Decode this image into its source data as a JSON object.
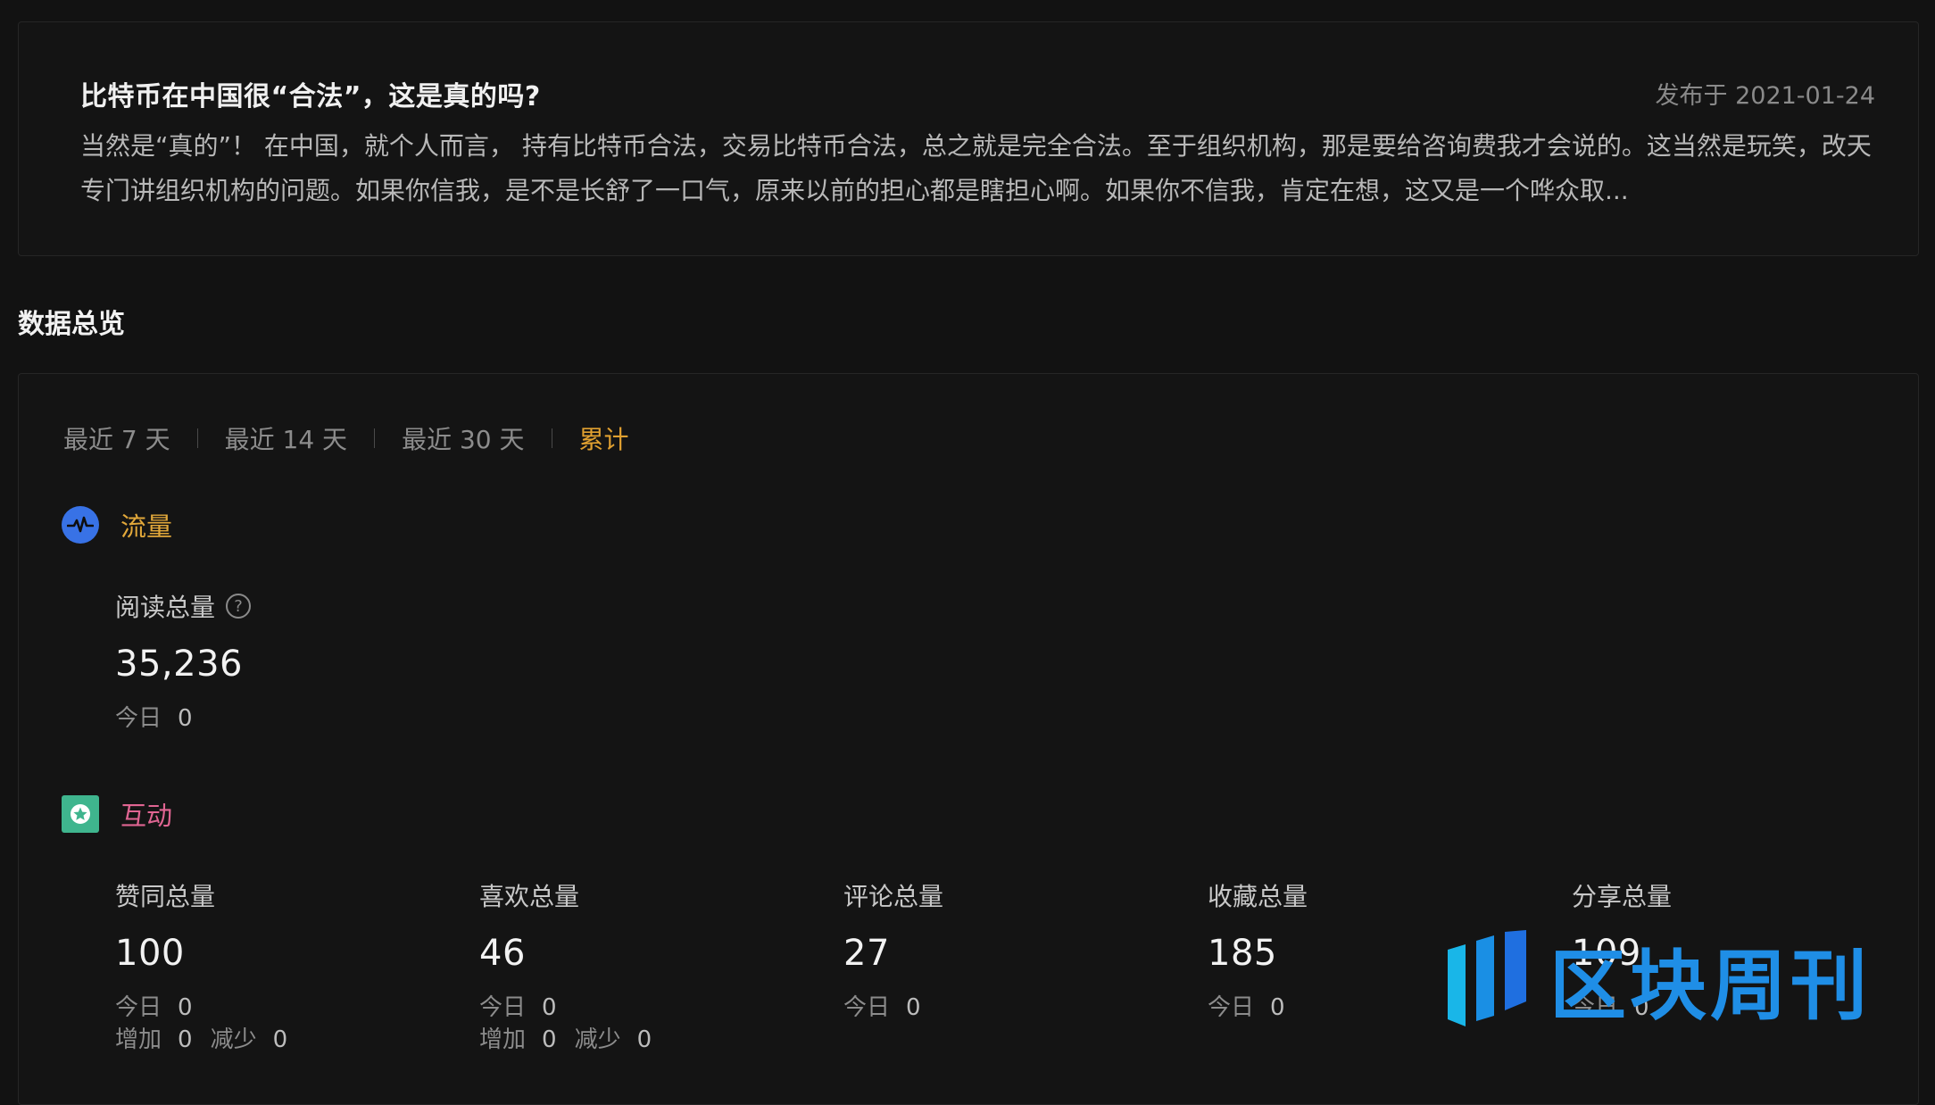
{
  "article": {
    "title": "比特币在中国很“合法”，这是真的吗?",
    "date": "发布于 2021-01-24",
    "summary": "当然是“真的”！ 在中国，就个人而言， 持有比特币合法，交易比特币合法，总之就是完全合法。至于组织机构，那是要给咨询费我才会说的。这当然是玩笑，改天专门讲组织机构的问题。如果你信我，是不是长舒了一口气，原来以前的担心都是瞎担心啊。如果你不信我，肯定在想，这又是一个哗众取..."
  },
  "overview": {
    "title": "数据总览",
    "tabs": [
      "最近 7 天",
      "最近 14 天",
      "最近 30 天",
      "累计"
    ],
    "active_tab": "累计",
    "traffic": {
      "label": "流量",
      "icon": "pulse-icon",
      "color": "#e2a83a",
      "reads": {
        "label": "阅读总量",
        "help": "?",
        "value": "35,236",
        "today_label": "今日",
        "today_value": "0"
      }
    },
    "interaction": {
      "label": "互动",
      "icon": "star-icon",
      "color": "#e06592",
      "metrics": [
        {
          "label": "赞同总量",
          "value": "100",
          "today_label": "今日",
          "today_value": "0",
          "inc_label": "增加",
          "inc_value": "0",
          "dec_label": "减少",
          "dec_value": "0"
        },
        {
          "label": "喜欢总量",
          "value": "46",
          "today_label": "今日",
          "today_value": "0",
          "inc_label": "增加",
          "inc_value": "0",
          "dec_label": "减少",
          "dec_value": "0"
        },
        {
          "label": "评论总量",
          "value": "27",
          "today_label": "今日",
          "today_value": "0"
        },
        {
          "label": "收藏总量",
          "value": "185",
          "today_label": "今日",
          "today_value": "0"
        },
        {
          "label": "分享总量",
          "value": "109",
          "today_label": "今日",
          "today_value": "0"
        }
      ]
    }
  },
  "watermark": {
    "text": "区块周刊"
  }
}
